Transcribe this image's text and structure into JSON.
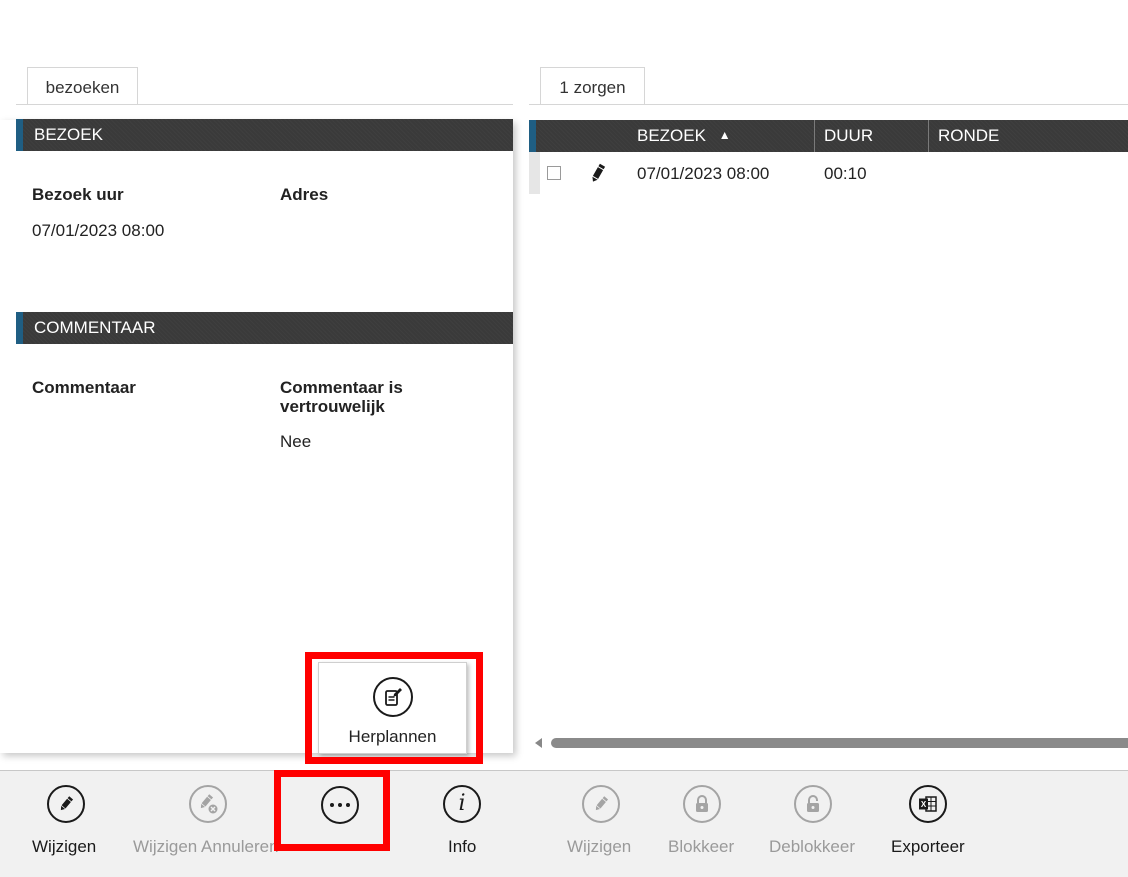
{
  "tabs": {
    "left": "bezoeken",
    "right": "1 zorgen"
  },
  "bezoek_section": {
    "title": "BEZOEK",
    "fields": [
      {
        "label": "Bezoek uur",
        "value": "07/01/2023 08:00"
      },
      {
        "label": "Adres",
        "value": ""
      }
    ]
  },
  "commentaar_section": {
    "title": "COMMENTAAR",
    "fields": [
      {
        "label": "Commentaar",
        "value": ""
      },
      {
        "label": "Commentaar is vertrouwelijk",
        "value": "Nee"
      }
    ]
  },
  "popup": {
    "label": "Herplannen",
    "icon": "reschedule-icon"
  },
  "grid": {
    "columns": [
      "BEZOEK",
      "DUUR",
      "RONDE"
    ],
    "sort_indicator": "▲",
    "rows": [
      {
        "bezoek": "07/01/2023 08:00",
        "duur": "00:10",
        "ronde": ""
      }
    ]
  },
  "toolbar": {
    "left": [
      {
        "label": "Wijzigen",
        "icon": "pencil-icon",
        "enabled": true
      },
      {
        "label": "Wijzigen Annuleren",
        "icon": "pencil-cancel-icon",
        "enabled": false
      },
      {
        "label": "",
        "icon": "more-icon",
        "enabled": true
      },
      {
        "label": "Info",
        "icon": "info-icon",
        "enabled": true
      }
    ],
    "right": [
      {
        "label": "Wijzigen",
        "icon": "pencil-icon",
        "enabled": false
      },
      {
        "label": "Blokkeer",
        "icon": "lock-icon",
        "enabled": false
      },
      {
        "label": "Deblokkeer",
        "icon": "unlock-icon",
        "enabled": false
      },
      {
        "label": "Exporteer",
        "icon": "excel-icon",
        "enabled": true
      }
    ]
  },
  "colors": {
    "header_bg": "#3a3a3a",
    "accent": "#1f5e83",
    "highlight": "#ff0000",
    "toolbar_bg": "#f1f1f1"
  }
}
